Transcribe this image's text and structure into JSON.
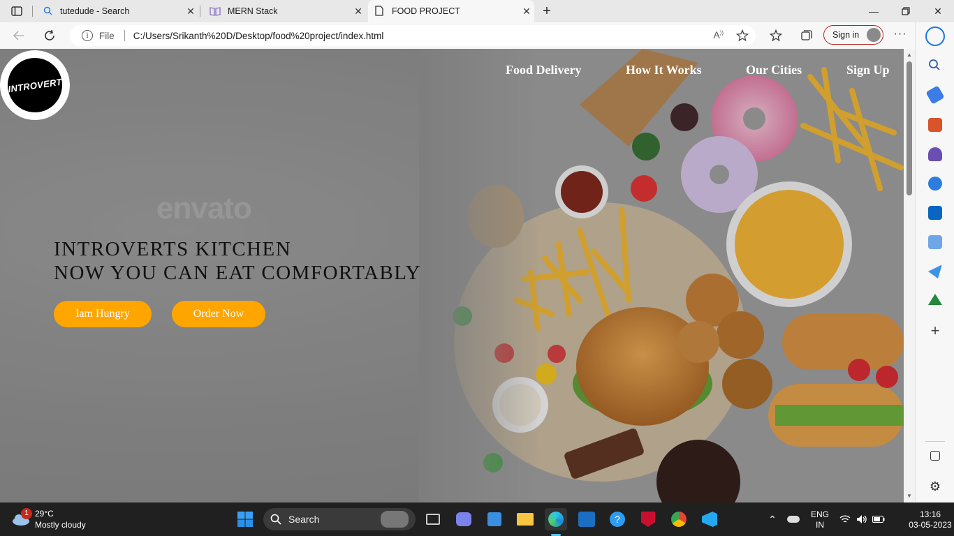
{
  "browser": {
    "tabs": [
      {
        "title": "tutedude - Search",
        "icon": "search-icon"
      },
      {
        "title": "MERN Stack",
        "icon": "book-icon"
      },
      {
        "title": "FOOD PROJECT",
        "icon": "page-icon",
        "active": true
      }
    ],
    "address": {
      "scheme_label": "File",
      "url": "C:/Users/Srikanth%20D/Desktop/food%20project/index.html"
    },
    "signin_label": "Sign in",
    "accent": "#b3261e"
  },
  "page": {
    "logo_text": "INTROVERT",
    "nav": [
      "Food Delivery",
      "How It Works",
      "Our Cities",
      "Sign Up"
    ],
    "watermark": "envato",
    "headline_line1": "INTROVERTS KITCHEN",
    "headline_line2": "NOW YOU CAN EAT COMFORTABLY",
    "buttons": {
      "hungry": "Iam Hungry",
      "order": "Order Now"
    },
    "button_color": "#ffa500"
  },
  "taskbar": {
    "weather_badge": "1",
    "temperature": "29°C",
    "condition": "Mostly cloudy",
    "search_label": "Search",
    "lang_line1": "ENG",
    "lang_line2": "IN",
    "time": "13:16",
    "date": "03-05-2023"
  }
}
